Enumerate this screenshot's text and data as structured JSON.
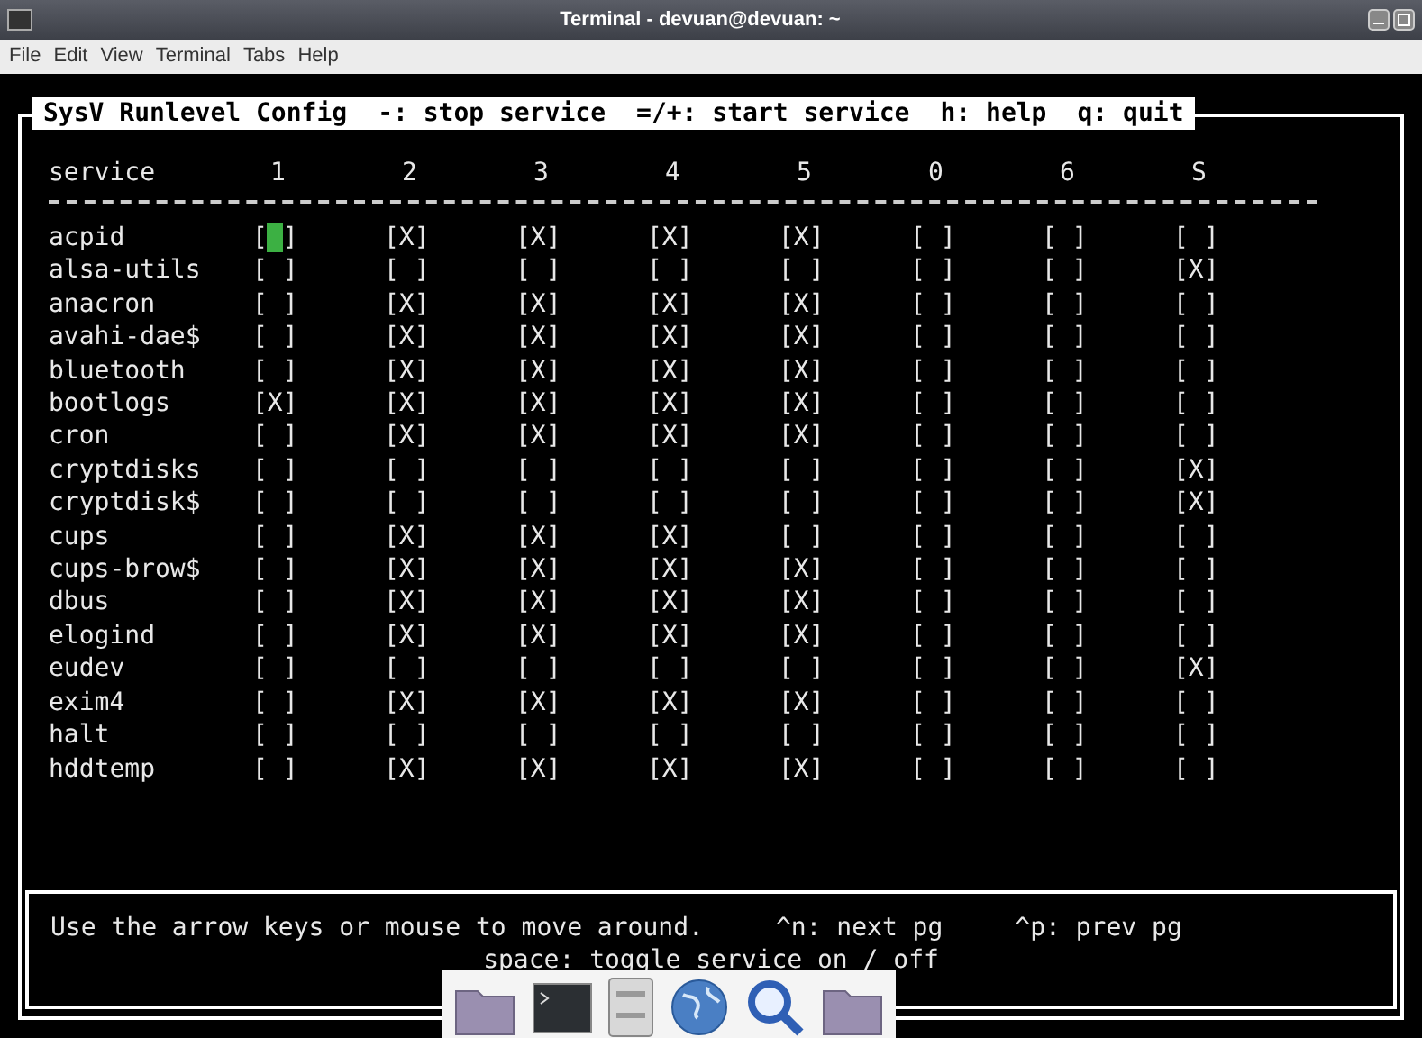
{
  "window": {
    "title": "Terminal - devuan@devuan: ~"
  },
  "menu": [
    "File",
    "Edit",
    "View",
    "Terminal",
    "Tabs",
    "Help"
  ],
  "header_bar": [
    "SysV Runlevel Config",
    "-: stop service",
    "=/+: start service",
    "h: help",
    "q: quit"
  ],
  "table": {
    "service_column": "service",
    "columns": [
      "1",
      "2",
      "3",
      "4",
      "5",
      "0",
      "6",
      "S"
    ],
    "rows": [
      {
        "service": "acpid",
        "cells": [
          {
            "text": "[ ]",
            "selected": true
          },
          {
            "text": "[X]",
            "selected": false
          },
          {
            "text": "[X]",
            "selected": false
          },
          {
            "text": "[X]",
            "selected": false
          },
          {
            "text": "[X]",
            "selected": false
          },
          {
            "text": "[ ]",
            "selected": false
          },
          {
            "text": "[ ]",
            "selected": false
          },
          {
            "text": "[ ]",
            "selected": false
          }
        ]
      },
      {
        "service": "alsa-utils",
        "cells": [
          {
            "text": "[ ]",
            "selected": false
          },
          {
            "text": "[ ]",
            "selected": false
          },
          {
            "text": "[ ]",
            "selected": false
          },
          {
            "text": "[ ]",
            "selected": false
          },
          {
            "text": "[ ]",
            "selected": false
          },
          {
            "text": "[ ]",
            "selected": false
          },
          {
            "text": "[ ]",
            "selected": false
          },
          {
            "text": "[X]",
            "selected": false
          }
        ]
      },
      {
        "service": "anacron",
        "cells": [
          {
            "text": "[ ]",
            "selected": false
          },
          {
            "text": "[X]",
            "selected": false
          },
          {
            "text": "[X]",
            "selected": false
          },
          {
            "text": "[X]",
            "selected": false
          },
          {
            "text": "[X]",
            "selected": false
          },
          {
            "text": "[ ]",
            "selected": false
          },
          {
            "text": "[ ]",
            "selected": false
          },
          {
            "text": "[ ]",
            "selected": false
          }
        ]
      },
      {
        "service": "avahi-dae$",
        "cells": [
          {
            "text": "[ ]",
            "selected": false
          },
          {
            "text": "[X]",
            "selected": false
          },
          {
            "text": "[X]",
            "selected": false
          },
          {
            "text": "[X]",
            "selected": false
          },
          {
            "text": "[X]",
            "selected": false
          },
          {
            "text": "[ ]",
            "selected": false
          },
          {
            "text": "[ ]",
            "selected": false
          },
          {
            "text": "[ ]",
            "selected": false
          }
        ]
      },
      {
        "service": "bluetooth",
        "cells": [
          {
            "text": "[ ]",
            "selected": false
          },
          {
            "text": "[X]",
            "selected": false
          },
          {
            "text": "[X]",
            "selected": false
          },
          {
            "text": "[X]",
            "selected": false
          },
          {
            "text": "[X]",
            "selected": false
          },
          {
            "text": "[ ]",
            "selected": false
          },
          {
            "text": "[ ]",
            "selected": false
          },
          {
            "text": "[ ]",
            "selected": false
          }
        ]
      },
      {
        "service": "bootlogs",
        "cells": [
          {
            "text": "[X]",
            "selected": false
          },
          {
            "text": "[X]",
            "selected": false
          },
          {
            "text": "[X]",
            "selected": false
          },
          {
            "text": "[X]",
            "selected": false
          },
          {
            "text": "[X]",
            "selected": false
          },
          {
            "text": "[ ]",
            "selected": false
          },
          {
            "text": "[ ]",
            "selected": false
          },
          {
            "text": "[ ]",
            "selected": false
          }
        ]
      },
      {
        "service": "cron",
        "cells": [
          {
            "text": "[ ]",
            "selected": false
          },
          {
            "text": "[X]",
            "selected": false
          },
          {
            "text": "[X]",
            "selected": false
          },
          {
            "text": "[X]",
            "selected": false
          },
          {
            "text": "[X]",
            "selected": false
          },
          {
            "text": "[ ]",
            "selected": false
          },
          {
            "text": "[ ]",
            "selected": false
          },
          {
            "text": "[ ]",
            "selected": false
          }
        ]
      },
      {
        "service": "cryptdisks",
        "cells": [
          {
            "text": "[ ]",
            "selected": false
          },
          {
            "text": "[ ]",
            "selected": false
          },
          {
            "text": "[ ]",
            "selected": false
          },
          {
            "text": "[ ]",
            "selected": false
          },
          {
            "text": "[ ]",
            "selected": false
          },
          {
            "text": "[ ]",
            "selected": false
          },
          {
            "text": "[ ]",
            "selected": false
          },
          {
            "text": "[X]",
            "selected": false
          }
        ]
      },
      {
        "service": "cryptdisk$",
        "cells": [
          {
            "text": "[ ]",
            "selected": false
          },
          {
            "text": "[ ]",
            "selected": false
          },
          {
            "text": "[ ]",
            "selected": false
          },
          {
            "text": "[ ]",
            "selected": false
          },
          {
            "text": "[ ]",
            "selected": false
          },
          {
            "text": "[ ]",
            "selected": false
          },
          {
            "text": "[ ]",
            "selected": false
          },
          {
            "text": "[X]",
            "selected": false
          }
        ]
      },
      {
        "service": "cups",
        "cells": [
          {
            "text": "[ ]",
            "selected": false
          },
          {
            "text": "[X]",
            "selected": false
          },
          {
            "text": "[X]",
            "selected": false
          },
          {
            "text": "[X]",
            "selected": false
          },
          {
            "text": "[ ]",
            "selected": false
          },
          {
            "text": "[ ]",
            "selected": false
          },
          {
            "text": "[ ]",
            "selected": false
          },
          {
            "text": "[ ]",
            "selected": false
          }
        ]
      },
      {
        "service": "cups-brow$",
        "cells": [
          {
            "text": "[ ]",
            "selected": false
          },
          {
            "text": "[X]",
            "selected": false
          },
          {
            "text": "[X]",
            "selected": false
          },
          {
            "text": "[X]",
            "selected": false
          },
          {
            "text": "[X]",
            "selected": false
          },
          {
            "text": "[ ]",
            "selected": false
          },
          {
            "text": "[ ]",
            "selected": false
          },
          {
            "text": "[ ]",
            "selected": false
          }
        ]
      },
      {
        "service": "dbus",
        "cells": [
          {
            "text": "[ ]",
            "selected": false
          },
          {
            "text": "[X]",
            "selected": false
          },
          {
            "text": "[X]",
            "selected": false
          },
          {
            "text": "[X]",
            "selected": false
          },
          {
            "text": "[X]",
            "selected": false
          },
          {
            "text": "[ ]",
            "selected": false
          },
          {
            "text": "[ ]",
            "selected": false
          },
          {
            "text": "[ ]",
            "selected": false
          }
        ]
      },
      {
        "service": "elogind",
        "cells": [
          {
            "text": "[ ]",
            "selected": false
          },
          {
            "text": "[X]",
            "selected": false
          },
          {
            "text": "[X]",
            "selected": false
          },
          {
            "text": "[X]",
            "selected": false
          },
          {
            "text": "[X]",
            "selected": false
          },
          {
            "text": "[ ]",
            "selected": false
          },
          {
            "text": "[ ]",
            "selected": false
          },
          {
            "text": "[ ]",
            "selected": false
          }
        ]
      },
      {
        "service": "eudev",
        "cells": [
          {
            "text": "[ ]",
            "selected": false
          },
          {
            "text": "[ ]",
            "selected": false
          },
          {
            "text": "[ ]",
            "selected": false
          },
          {
            "text": "[ ]",
            "selected": false
          },
          {
            "text": "[ ]",
            "selected": false
          },
          {
            "text": "[ ]",
            "selected": false
          },
          {
            "text": "[ ]",
            "selected": false
          },
          {
            "text": "[X]",
            "selected": false
          }
        ]
      },
      {
        "service": "exim4",
        "cells": [
          {
            "text": "[ ]",
            "selected": false
          },
          {
            "text": "[X]",
            "selected": false
          },
          {
            "text": "[X]",
            "selected": false
          },
          {
            "text": "[X]",
            "selected": false
          },
          {
            "text": "[X]",
            "selected": false
          },
          {
            "text": "[ ]",
            "selected": false
          },
          {
            "text": "[ ]",
            "selected": false
          },
          {
            "text": "[ ]",
            "selected": false
          }
        ]
      },
      {
        "service": "halt",
        "cells": [
          {
            "text": "[ ]",
            "selected": false
          },
          {
            "text": "[ ]",
            "selected": false
          },
          {
            "text": "[ ]",
            "selected": false
          },
          {
            "text": "[ ]",
            "selected": false
          },
          {
            "text": "[ ]",
            "selected": false
          },
          {
            "text": "[ ]",
            "selected": false
          },
          {
            "text": "[ ]",
            "selected": false
          },
          {
            "text": "[ ]",
            "selected": false
          }
        ]
      },
      {
        "service": "hddtemp",
        "cells": [
          {
            "text": "[ ]",
            "selected": false
          },
          {
            "text": "[X]",
            "selected": false
          },
          {
            "text": "[X]",
            "selected": false
          },
          {
            "text": "[X]",
            "selected": false
          },
          {
            "text": "[X]",
            "selected": false
          },
          {
            "text": "[ ]",
            "selected": false
          },
          {
            "text": "[ ]",
            "selected": false
          },
          {
            "text": "[ ]",
            "selected": false
          }
        ]
      }
    ]
  },
  "help": {
    "line_1": [
      "Use the arrow keys or mouse to move around.",
      "^n: next pg",
      "^p: prev pg"
    ],
    "line_2": "space: toggle service on / off"
  }
}
